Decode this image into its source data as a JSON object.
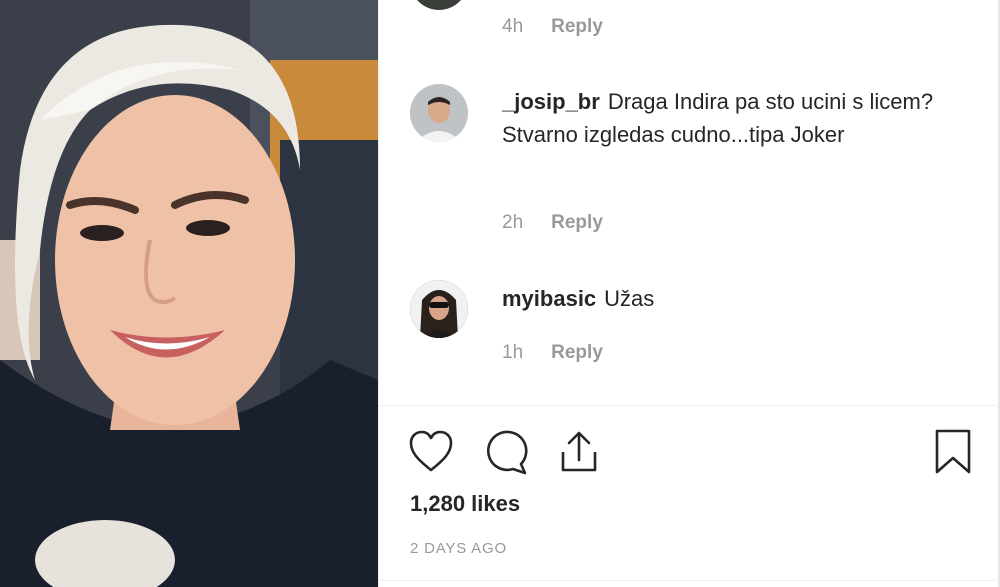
{
  "comments": [
    {
      "username": "",
      "text": "",
      "time": "4h",
      "reply_label": "Reply"
    },
    {
      "username": "_josip_br",
      "text": "Draga Indira pa sto ucini s licem? Stvarno izgledas cudno...tipa Joker",
      "time": "2h",
      "reply_label": "Reply"
    },
    {
      "username": "myibasic",
      "text": "Užas",
      "time": "1h",
      "reply_label": "Reply"
    }
  ],
  "actions": {
    "like_icon": "heart-icon",
    "comment_icon": "comment-bubble-icon",
    "share_icon": "share-upload-icon",
    "save_icon": "bookmark-icon"
  },
  "likes": "1,280 likes",
  "post_date": "2 DAYS AGO"
}
